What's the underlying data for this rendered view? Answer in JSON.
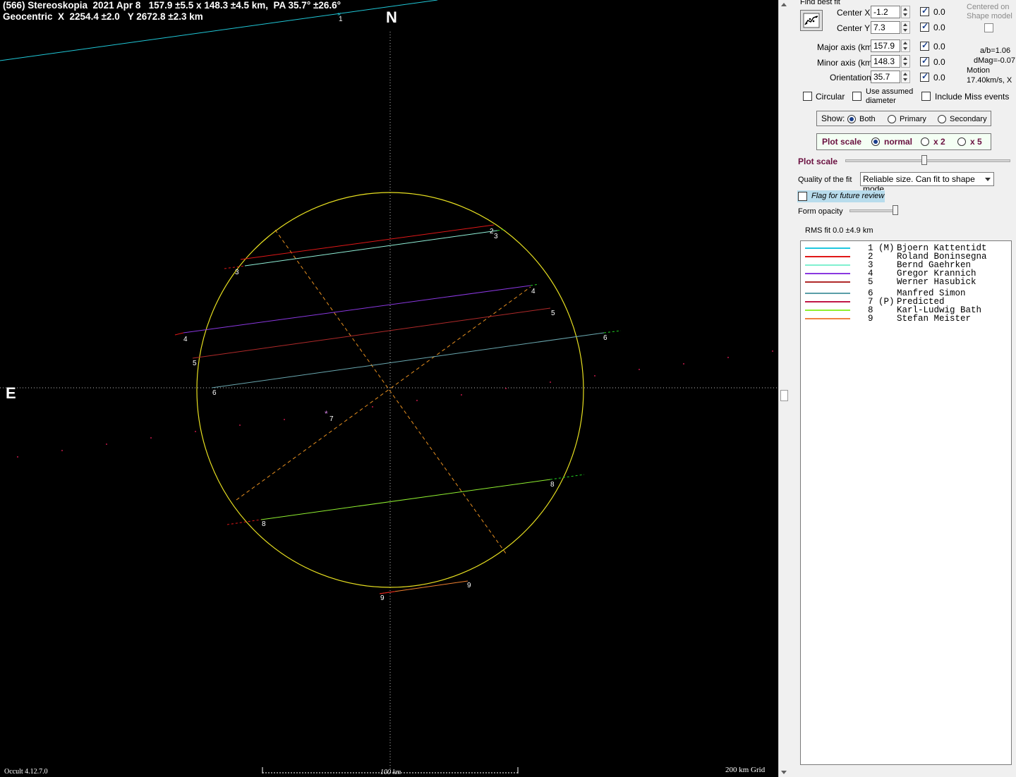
{
  "header": {
    "line1": "(566) Stereoskopia  2021 Apr 8   157.9 ±5.5 x 148.3 ±4.5 km,  PA 35.7° ±26.6°",
    "line2": "Geocentric  X  2254.4 ±2.0   Y 2672.8 ±2.3 km"
  },
  "compass": {
    "north": "N",
    "east": "E"
  },
  "footer": {
    "version": "Occult 4.12.7.0",
    "scale": "100 km",
    "grid": "200 km Grid"
  },
  "chords": [
    {
      "num": "1",
      "color": "#20c8d8"
    },
    {
      "num": "2",
      "color": "#e01818"
    },
    {
      "num": "3",
      "color": "#90f0d8"
    },
    {
      "num": "4",
      "color": "#8a38e0"
    },
    {
      "num": "5",
      "color": "#b02a2a"
    },
    {
      "num": "6",
      "color": "#6aa8b0"
    },
    {
      "num": "7",
      "color": "#c01848"
    },
    {
      "num": "8",
      "color": "#90f030"
    },
    {
      "num": "9",
      "color": "#f08030"
    }
  ],
  "panel": {
    "find_best_fit": "Find best fit",
    "center_x_label": "Center X",
    "center_x_value": "-1.2",
    "center_x_unc": "0.0",
    "center_y_label": "Center Y",
    "center_y_value": "7.3",
    "center_y_unc": "0.0",
    "centered_on": "Centered on",
    "shape_model": "Shape model",
    "major_label": "Major axis (km)",
    "major_value": "157.9",
    "major_unc": "0.0",
    "minor_label": "Minor axis (km)",
    "minor_value": "148.3",
    "minor_unc": "0.0",
    "orient_label": "Orientation",
    "orient_value": "35.7",
    "orient_unc": "0.0",
    "ab": "a/b=1.06",
    "dmag": "dMag=-0.07",
    "motion": "Motion",
    "motion_val": "17.40km/s, X",
    "circular": "Circular",
    "use_assumed_1": "Use assumed",
    "use_assumed_2": "diameter",
    "include_miss": "Include Miss events",
    "show_label": "Show:",
    "show_both": "Both",
    "show_primary": "Primary",
    "show_secondary": "Secondary",
    "plot_scale": "Plot scale",
    "ps_normal": "normal",
    "ps_x2": "x 2",
    "ps_x5": "x 5",
    "plot_scale2": "Plot scale",
    "quality_label": "Quality of the fit",
    "quality_value": "Reliable size. Can fit to shape mode",
    "flag": "Flag for future review",
    "form_opacity": "Form opacity",
    "rms": "RMS fit  0.0 ±4.9 km"
  },
  "legend": [
    {
      "num": "1 (M)",
      "name": "Bjoern Kattentidt",
      "color": "#20c8e0"
    },
    {
      "num": "2",
      "name": "Roland Boninsegna",
      "color": "#e01818"
    },
    {
      "num": "3",
      "name": "Bernd Gaehrken",
      "color": "#80f0d0"
    },
    {
      "num": "4",
      "name": "Gregor Krannich",
      "color": "#8a38e0"
    },
    {
      "num": "5",
      "name": "Werner Hasubick",
      "color": "#b02a2a"
    },
    {
      "num": "6",
      "name": "Manfred Simon",
      "color": "#5a9ea8"
    },
    {
      "num": "7 (P)",
      "name": "Predicted",
      "color": "#c01848"
    },
    {
      "num": "8",
      "name": "Karl-Ludwig Bath",
      "color": "#90f030"
    },
    {
      "num": "9",
      "name": "Stefan Meister",
      "color": "#f08040"
    }
  ]
}
